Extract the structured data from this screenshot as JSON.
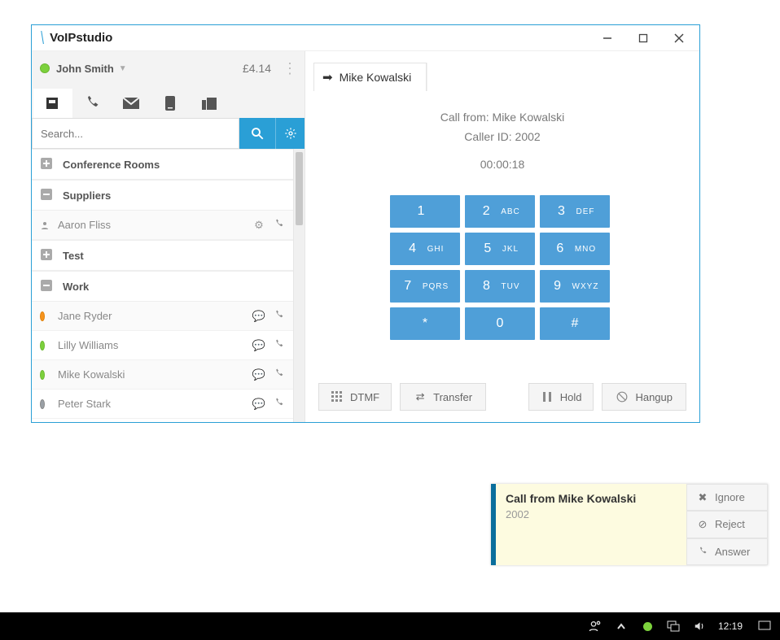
{
  "window": {
    "title": "VoIPstudio"
  },
  "user": {
    "name": "John Smith",
    "balance": "£4.14"
  },
  "search": {
    "placeholder": "Search..."
  },
  "groups": {
    "conference": "Conference Rooms",
    "suppliers": "Suppliers",
    "test": "Test",
    "work": "Work"
  },
  "contacts": {
    "aaron": "Aaron Fliss",
    "jane": "Jane Ryder",
    "lilly": "Lilly Williams",
    "mike": "Mike Kowalski",
    "peter": "Peter Stark"
  },
  "call": {
    "tab_name": "Mike Kowalski",
    "from_label": "Call from: Mike Kowalski",
    "caller_id": "Caller ID: 2002",
    "timer": "00:00:18"
  },
  "keypad": {
    "k1": {
      "num": "1",
      "let": ""
    },
    "k2": {
      "num": "2",
      "let": "ABC"
    },
    "k3": {
      "num": "3",
      "let": "DEF"
    },
    "k4": {
      "num": "4",
      "let": "GHI"
    },
    "k5": {
      "num": "5",
      "let": "JKL"
    },
    "k6": {
      "num": "6",
      "let": "MNO"
    },
    "k7": {
      "num": "7",
      "let": "PQRS"
    },
    "k8": {
      "num": "8",
      "let": "TUV"
    },
    "k9": {
      "num": "9",
      "let": "WXYZ"
    },
    "kstar": {
      "num": "*",
      "let": ""
    },
    "k0": {
      "num": "0",
      "let": ""
    },
    "khash": {
      "num": "#",
      "let": ""
    }
  },
  "actions": {
    "dtmf": "DTMF",
    "transfer": "Transfer",
    "hold": "Hold",
    "hangup": "Hangup"
  },
  "toast": {
    "title": "Call from Mike Kowalski",
    "cid": "2002",
    "ignore": "Ignore",
    "reject": "Reject",
    "answer": "Answer"
  },
  "taskbar": {
    "clock": "12:19"
  }
}
